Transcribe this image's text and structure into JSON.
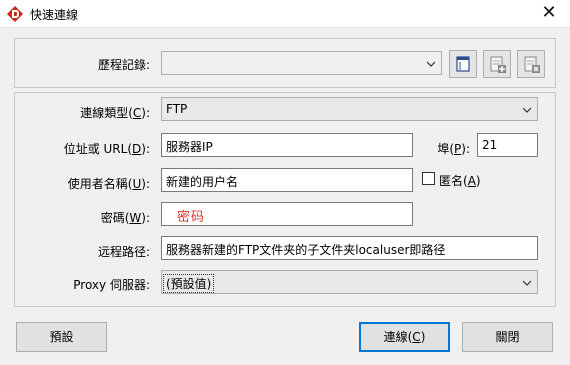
{
  "window": {
    "title": "快速連線",
    "close_glyph": "✕"
  },
  "history": {
    "label": "歷程記錄:",
    "value": ""
  },
  "icons": [
    "list-view-icon",
    "add-site-icon",
    "delete-site-icon"
  ],
  "connection_type": {
    "label_pre": "連線類型(",
    "label_key": "C",
    "label_post": "):",
    "value": "FTP"
  },
  "address": {
    "label_pre": "位址或 URL(",
    "label_key": "D",
    "label_post": "):",
    "value": "服務器IP"
  },
  "port": {
    "label_pre": "埠(",
    "label_key": "P",
    "label_post": "):",
    "value": "21"
  },
  "username": {
    "label_pre": "使用者名稱(",
    "label_key": "U",
    "label_post": "):",
    "value": "新建的用户名"
  },
  "anonymous": {
    "label_pre": "匿名(",
    "label_key": "A",
    "label_post": ")",
    "checked": false
  },
  "password": {
    "label_pre": "密碼(",
    "label_key": "W",
    "label_post": "):",
    "value": "密码",
    "value_color": "#e0352b"
  },
  "remote_path": {
    "label": "远程路径:",
    "value": "服務器新建的FTP文件夹的子文件夹localuser即路径"
  },
  "proxy": {
    "label": "Proxy 伺服器:",
    "value": "(預設值)"
  },
  "buttons": {
    "default_label": "預設",
    "connect_pre": "連線(",
    "connect_key": "C",
    "connect_post": ")",
    "close_label": "關閉"
  }
}
